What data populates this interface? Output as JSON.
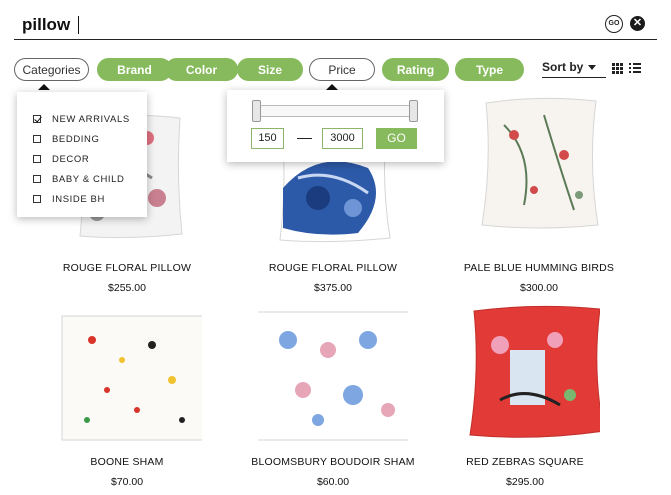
{
  "search": {
    "query": "pillow",
    "go_label": "GO",
    "clear_symbol": "✕"
  },
  "filters": [
    {
      "label": "Categories",
      "style": "outline"
    },
    {
      "label": "Brand",
      "style": "filled"
    },
    {
      "label": "Color",
      "style": "filled"
    },
    {
      "label": "Size",
      "style": "filled"
    },
    {
      "label": "Price",
      "style": "outline"
    },
    {
      "label": "Rating",
      "style": "filled"
    },
    {
      "label": "Type",
      "style": "filled"
    }
  ],
  "sort": {
    "label": "Sort by"
  },
  "view_icons": [
    "grid-view-icon",
    "list-view-icon"
  ],
  "categories": {
    "items": [
      {
        "label": "NEW ARRIVALS",
        "checked": true
      },
      {
        "label": "BEDDING",
        "checked": false
      },
      {
        "label": "DECOR",
        "checked": false
      },
      {
        "label": "BABY & CHILD",
        "checked": false
      },
      {
        "label": "INSIDE BH",
        "checked": false
      }
    ]
  },
  "price_filter": {
    "min": "150",
    "max": "3000",
    "go_label": "GO"
  },
  "products": [
    {
      "name": "ROUGE FLORAL PILLOW",
      "price": "$255.00"
    },
    {
      "name": "ROUGE FLORAL PILLOW",
      "price": "$375.00"
    },
    {
      "name": "PALE BLUE HUMMING BIRDS",
      "price": "$300.00"
    },
    {
      "name": "BOONE SHAM",
      "price": "$70.00"
    },
    {
      "name": "BLOOMSBURY BOUDOIR SHAM",
      "price": "$60.00"
    },
    {
      "name": "RED ZEBRAS SQUARE",
      "price": "$295.00"
    }
  ],
  "colors": {
    "accent_green": "#86ba5c",
    "text_dark": "#222222"
  }
}
